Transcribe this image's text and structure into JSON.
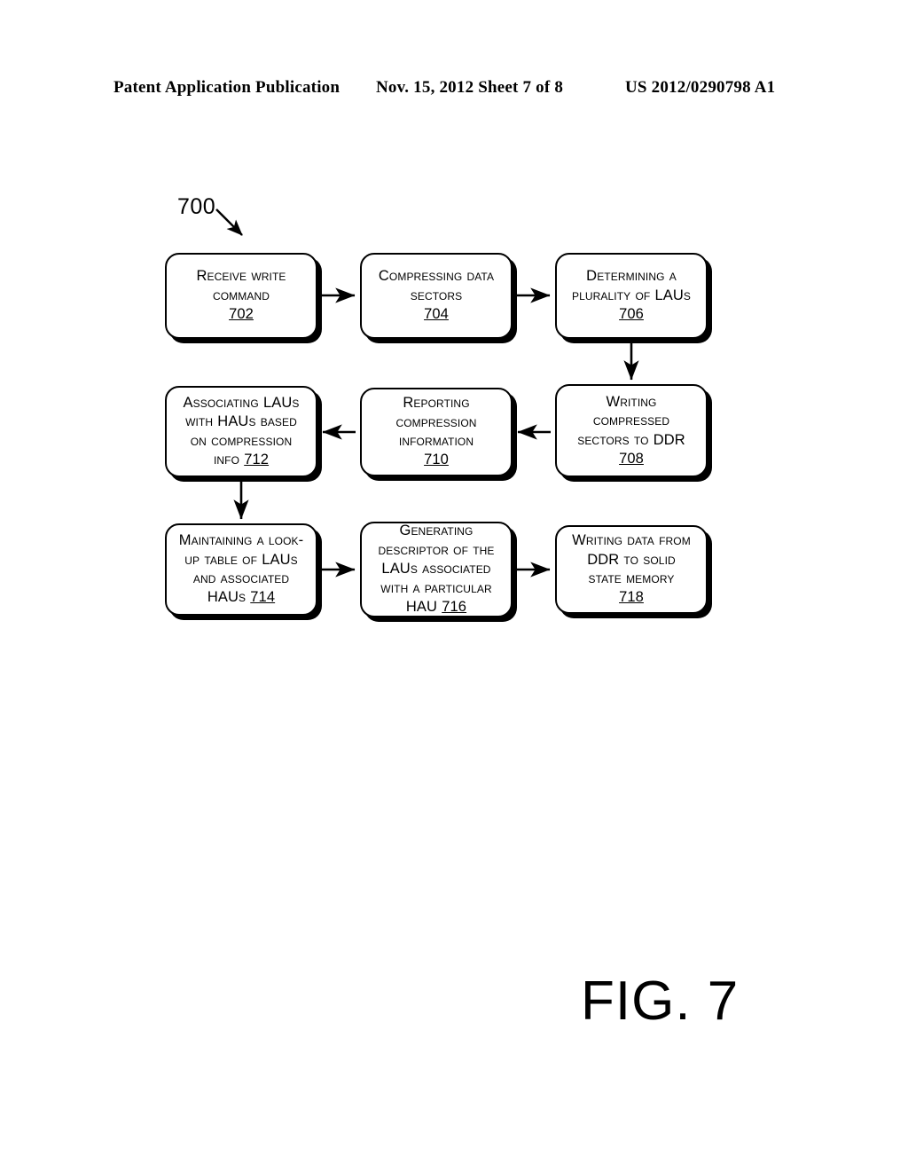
{
  "header": {
    "left": "Patent Application Publication",
    "middle": "Nov. 15, 2012  Sheet 7 of 8",
    "right": "US 2012/0290798 A1"
  },
  "figure": {
    "ref_number": "700",
    "caption": "FIG. 7"
  },
  "nodes": [
    {
      "id": "702",
      "lines": [
        "Receive write",
        "command"
      ],
      "ref": "702"
    },
    {
      "id": "704",
      "lines": [
        "Compressing data",
        "sectors"
      ],
      "ref": "704"
    },
    {
      "id": "706",
      "lines": [
        "Determining a",
        "plurality of LAUs"
      ],
      "ref": "706"
    },
    {
      "id": "708",
      "lines": [
        "Writing",
        "compressed",
        "sectors to DDR"
      ],
      "ref": "708"
    },
    {
      "id": "710",
      "lines": [
        "Reporting",
        "compression",
        "information"
      ],
      "ref": "710"
    },
    {
      "id": "712",
      "lines": [
        "Associating LAUs",
        "with HAUs based",
        "on compression",
        "info"
      ],
      "ref": "712",
      "ref_inline": true
    },
    {
      "id": "714",
      "lines": [
        "Maintaining a look-",
        "up table of LAUs",
        "and associated",
        "HAUs"
      ],
      "ref": "714",
      "ref_inline": true
    },
    {
      "id": "716",
      "lines": [
        "Generating",
        "descriptor of the",
        "LAUs associated",
        "with a particular",
        "HAU"
      ],
      "ref": "716",
      "ref_inline": true
    },
    {
      "id": "718",
      "lines": [
        "Writing data from",
        "DDR to solid",
        "state memory"
      ],
      "ref": "718"
    }
  ],
  "connectors": [
    {
      "name": "arrow-702-to-704",
      "from": "702",
      "to": "704",
      "direction": "right"
    },
    {
      "name": "arrow-704-to-706",
      "from": "704",
      "to": "706",
      "direction": "right"
    },
    {
      "name": "arrow-706-to-708",
      "from": "706",
      "to": "708",
      "direction": "down"
    },
    {
      "name": "arrow-708-to-710",
      "from": "708",
      "to": "710",
      "direction": "left"
    },
    {
      "name": "arrow-710-to-712",
      "from": "710",
      "to": "712",
      "direction": "left"
    },
    {
      "name": "arrow-712-to-714",
      "from": "712",
      "to": "714",
      "direction": "down"
    },
    {
      "name": "arrow-714-to-716",
      "from": "714",
      "to": "716",
      "direction": "right"
    },
    {
      "name": "arrow-716-to-718",
      "from": "716",
      "to": "718",
      "direction": "right"
    }
  ]
}
